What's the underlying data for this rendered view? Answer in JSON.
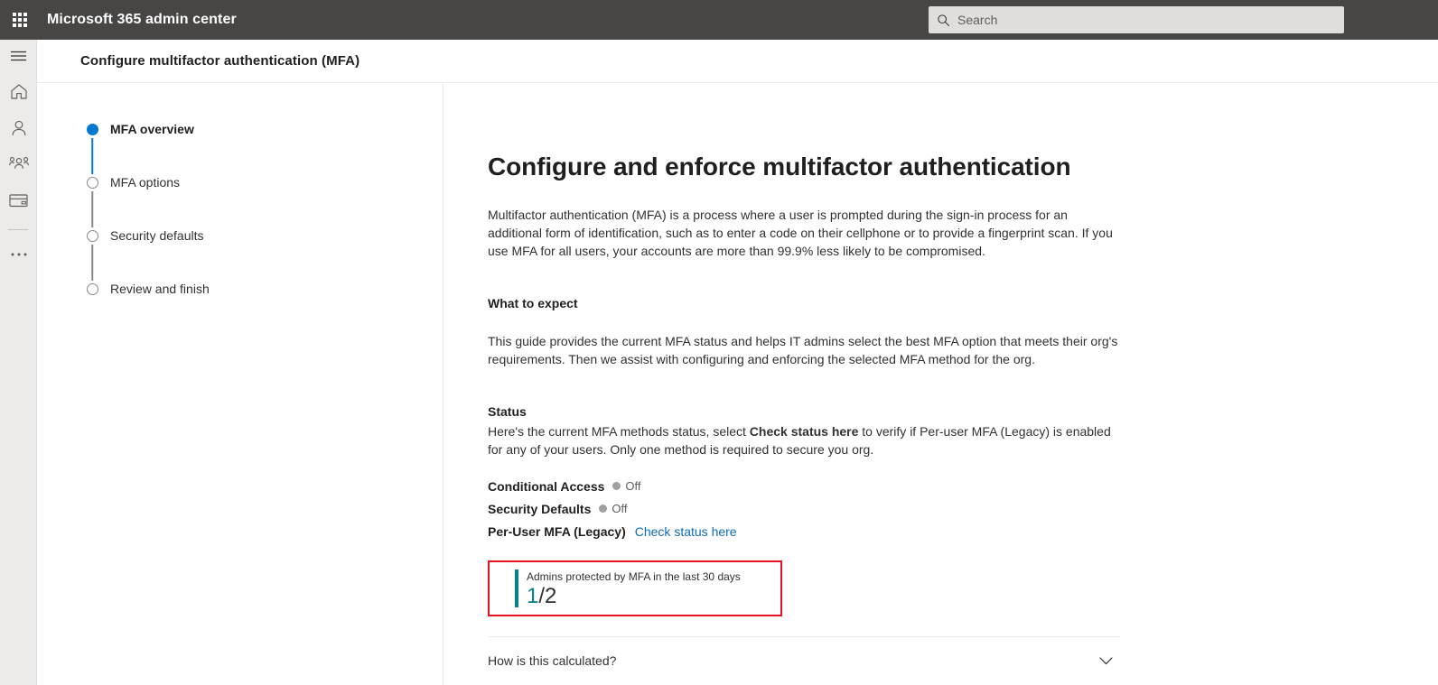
{
  "header": {
    "app_launcher_icon": "waffle-grid-icon",
    "suite_title": "Microsoft 365 admin center",
    "search": {
      "icon": "search-icon",
      "placeholder": "Search",
      "value": ""
    }
  },
  "rail": {
    "items": [
      {
        "icon": "hamburger-menu-icon",
        "name": "nav-toggle"
      },
      {
        "icon": "home-icon",
        "name": "home"
      },
      {
        "icon": "user-icon",
        "name": "users"
      },
      {
        "icon": "people-group-icon",
        "name": "teams-groups"
      },
      {
        "icon": "credit-card-icon",
        "name": "billing"
      },
      {
        "icon": "ellipsis-icon",
        "name": "show-all"
      }
    ]
  },
  "page": {
    "title": "Configure multifactor authentication (MFA)"
  },
  "wizard": {
    "steps": [
      {
        "label": "MFA overview",
        "state": "active"
      },
      {
        "label": "MFA options",
        "state": "upcoming"
      },
      {
        "label": "Security defaults",
        "state": "upcoming"
      },
      {
        "label": "Review and finish",
        "state": "upcoming"
      }
    ]
  },
  "main": {
    "heading": "Configure and enforce multifactor authentication",
    "intro": "Multifactor authentication (MFA) is a process where a user is prompted during the sign-in process for an additional form of identification, such as to enter a code on their cellphone or to provide a fingerprint scan. If you use MFA for all users, your accounts are more than 99.9% less likely to be compromised.",
    "what_to_expect": {
      "heading": "What to expect",
      "text": "This guide provides the current MFA status and helps IT admins select the best MFA option that meets their org's requirements. Then we assist with configuring and enforcing the selected MFA method for the org."
    },
    "status": {
      "heading": "Status",
      "description_part1": "Here's the current MFA methods status, select ",
      "description_bold": "Check status here",
      "description_part2": " to verify if Per-user MFA (Legacy) is enabled for any of your users. Only one method is required to secure you org.",
      "rows": [
        {
          "name": "Conditional Access",
          "value": "Off",
          "indicator": "off-dot",
          "type": "value"
        },
        {
          "name": "Security Defaults",
          "value": "Off",
          "indicator": "off-dot",
          "type": "value"
        },
        {
          "name": "Per-User MFA (Legacy)",
          "link": "Check status here",
          "type": "link"
        }
      ]
    },
    "metric": {
      "label": "Admins protected by MFA in the last 30 days",
      "numerator": "1",
      "denominator": "/2",
      "accent_color": "#038387",
      "annotation_color": "#e81123"
    },
    "accordion": {
      "label": "How is this calculated?",
      "icon": "chevron-down-icon",
      "expanded": false
    }
  },
  "colors": {
    "header_background": "#484644",
    "rail_background": "#edebe9",
    "accent_blue": "#0078d4",
    "link_blue": "#0f6cbd",
    "teal": "#038387",
    "annotation_red": "#e81123"
  }
}
